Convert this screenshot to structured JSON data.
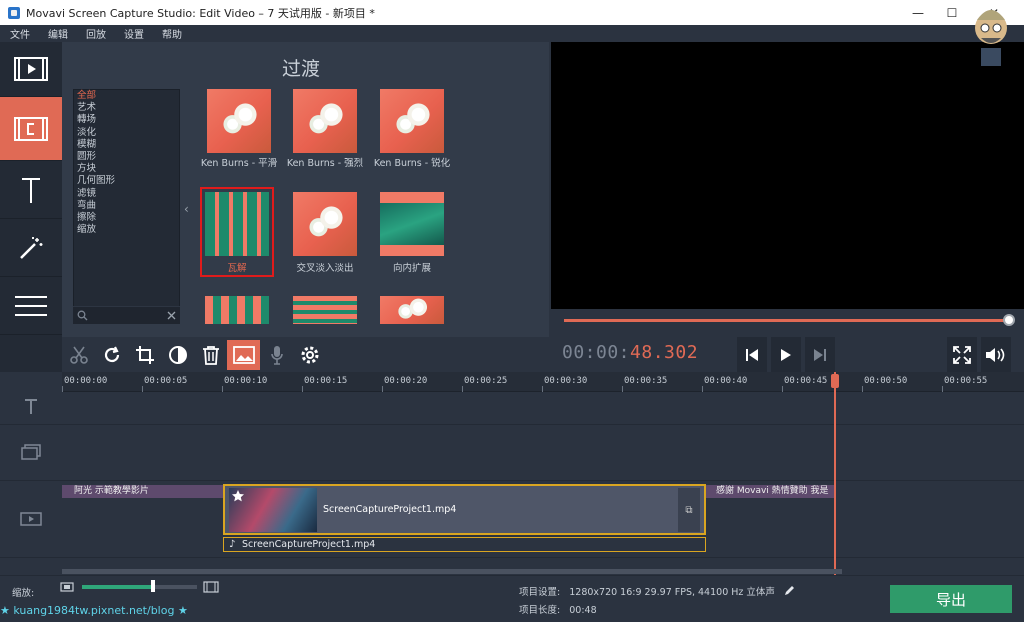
{
  "window": {
    "title": "Movavi Screen Capture Studio: Edit Video – 7 天试用版 - 新项目 *",
    "minimize": "—",
    "maximize": "☐",
    "close": "✕"
  },
  "menu": [
    "文件",
    "编辑",
    "回放",
    "设置",
    "帮助"
  ],
  "nav": [
    "media-icon",
    "transitions-icon",
    "titles-icon",
    "filters-icon",
    "more-icon"
  ],
  "transitions": {
    "title": "过渡",
    "categories": [
      "全部",
      "艺术",
      "轉场",
      "淡化",
      "模糊",
      "圆形",
      "方块",
      "几何图形",
      "滤镜",
      "弯曲",
      "擦除",
      "缩放"
    ],
    "active_category": "全部",
    "items": [
      {
        "label": "Ken Burns - 平滑"
      },
      {
        "label": "Ken Burns - 强烈"
      },
      {
        "label": "Ken Burns - 锐化"
      },
      {
        "label": "瓦解"
      },
      {
        "label": "交叉淡入淡出"
      },
      {
        "label": "向内扩展"
      }
    ]
  },
  "player": {
    "time_dim": "00:00:",
    "time_hi": "48.302",
    "progress": 1.0
  },
  "timeline": {
    "ticks": [
      "00:00:00",
      "00:00:05",
      "00:00:10",
      "00:00:15",
      "00:00:20",
      "00:00:25",
      "00:00:30",
      "00:00:35",
      "00:00:40",
      "00:00:45",
      "00:00:50",
      "00:00:55"
    ],
    "title_left": "阿光 示範教學影片",
    "title_right": "感謝 Movavi 熱情贊助 我是",
    "video_clip": "ScreenCaptureProject1.mp4",
    "audio_clip": "ScreenCaptureProject1.mp4"
  },
  "bottom": {
    "zoom_label": "缩放:",
    "zoom_level": 0.6,
    "settings_label": "项目设置:",
    "settings_value": "1280x720 16:9 29.97 FPS, 44100 Hz 立体声",
    "length_label": "项目长度:",
    "length_value": "00:48",
    "export": "导出",
    "watermark": "★ kuang1984tw.pixnet.net/blog ★"
  },
  "colors": {
    "accent": "#e06a55",
    "selection": "#e01b1b",
    "export": "#2f9b6a",
    "clip_border": "#d9a521"
  }
}
